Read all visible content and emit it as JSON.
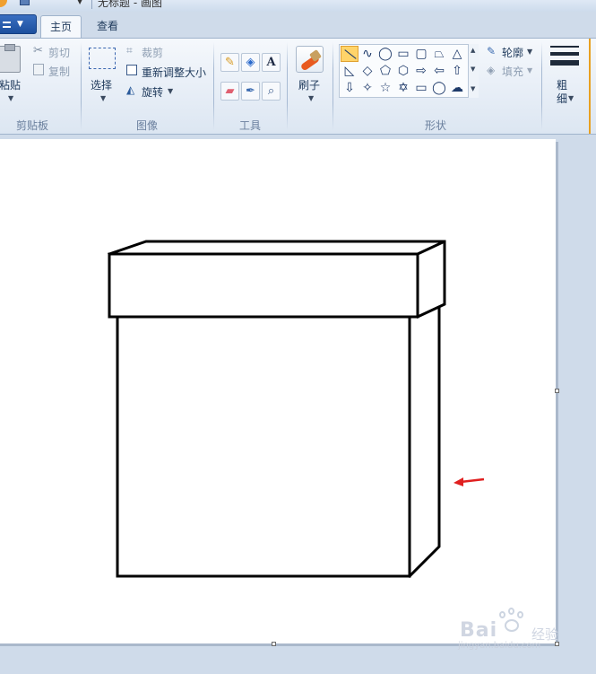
{
  "window": {
    "title": "无标题 - 画图"
  },
  "tabs": {
    "home": "主页",
    "view": "查看"
  },
  "ribbon": {
    "clipboard": {
      "paste": "粘贴",
      "cut": "剪切",
      "copy": "复制",
      "label": "剪贴板"
    },
    "image": {
      "select": "选择",
      "crop": "裁剪",
      "resize": "重新调整大小",
      "rotate": "旋转",
      "label": "图像"
    },
    "tools": {
      "label": "工具"
    },
    "brushes": {
      "brush": "刷子"
    },
    "shapes": {
      "outline": "轮廓",
      "fill": "填充",
      "label": "形状",
      "items": [
        "line",
        "curve",
        "oval",
        "rectangle",
        "rounded-rectangle",
        "polygon",
        "triangle",
        "right-triangle",
        "diamond",
        "pentagon",
        "hexagon",
        "right-arrow",
        "left-arrow",
        "up-arrow",
        "down-arrow",
        "four-point-star",
        "five-point-star",
        "six-point-star",
        "rounded-callout",
        "oval-callout",
        "cloud-callout"
      ]
    },
    "size": {
      "label_line1": "粗",
      "label_line2": "细"
    }
  },
  "canvas": {
    "annotation_arrow_color": "#e02020"
  },
  "watermark": {
    "brand": "Bai",
    "brand_suffix": "经验",
    "url": "jingyan.baidu.com"
  },
  "colors": {
    "ribbon_bg": "#dce6f2",
    "canvas_bg": "#ffffff",
    "workspace_bg": "#cfdbea",
    "selected_shape": "#ffd46a"
  }
}
